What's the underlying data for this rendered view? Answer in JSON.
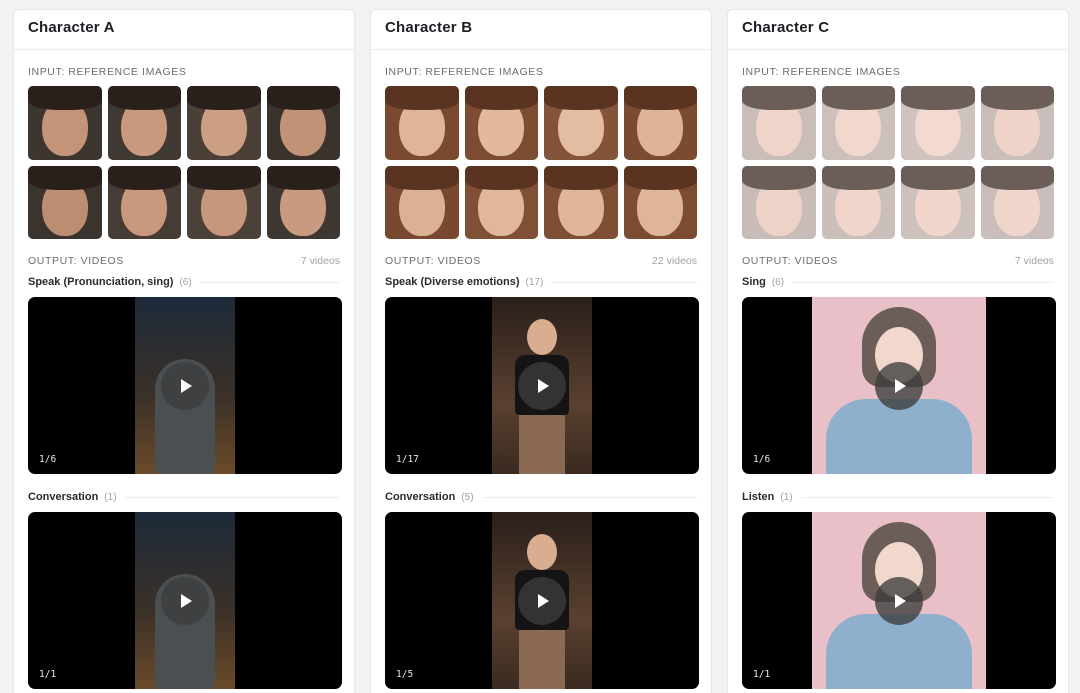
{
  "labels": {
    "input": "INPUT: REFERENCE IMAGES",
    "output": "OUTPUT: VIDEOS"
  },
  "characters": [
    {
      "title": "Character A",
      "videos_count": "7 videos",
      "palette": {
        "bg": "#3a3530",
        "skin": "#c89a80",
        "hair": "#2b211c"
      },
      "categories": [
        {
          "name": "Speak (Pronunciation, sing)",
          "count": "(6)",
          "counter": "1/6"
        },
        {
          "name": "Conversation",
          "count": "(1)",
          "counter": "1/1"
        }
      ]
    },
    {
      "title": "Character B",
      "videos_count": "22 videos",
      "palette": {
        "bg": "#7d4e34",
        "skin": "#e0b89c",
        "hair": "#5a3220"
      },
      "categories": [
        {
          "name": "Speak (Diverse emotions)",
          "count": "(17)",
          "counter": "1/17"
        },
        {
          "name": "Conversation",
          "count": "(5)",
          "counter": "1/5"
        }
      ]
    },
    {
      "title": "Character C",
      "videos_count": "7 videos",
      "palette": {
        "bg": "#c9bfbc",
        "skin": "#f1d6cc",
        "hair": "#6b5e58"
      },
      "categories": [
        {
          "name": "Sing",
          "count": "(6)",
          "counter": "1/6"
        },
        {
          "name": "Listen",
          "count": "(1)",
          "counter": "1/1"
        }
      ]
    }
  ]
}
